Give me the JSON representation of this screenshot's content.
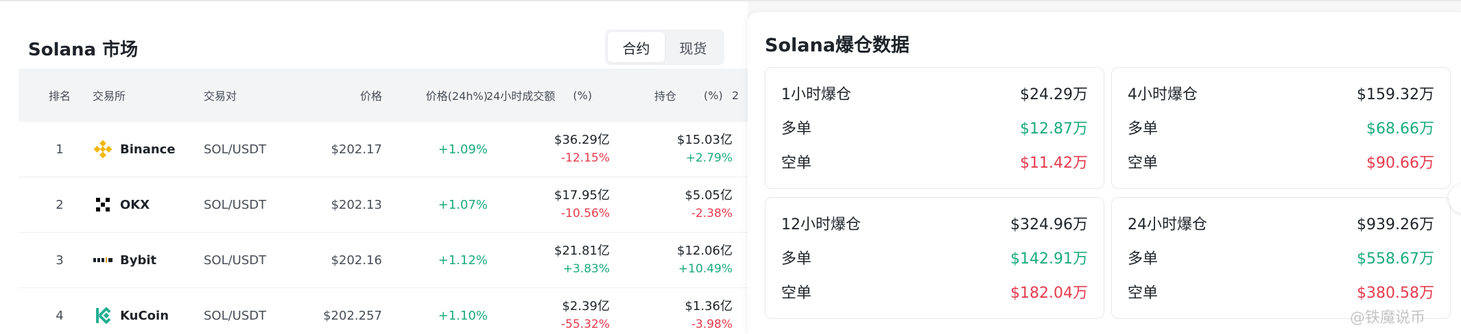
{
  "market": {
    "title": "Solana 市场",
    "tabs": [
      {
        "label": "合约",
        "active": true
      },
      {
        "label": "现货",
        "active": false
      }
    ],
    "columns": {
      "rank": "排名",
      "exchange": "交易所",
      "pair": "交易对",
      "price": "价格",
      "change": "价格(24h%)",
      "volume": "24小时成交额",
      "volume_pct": "(%)",
      "oi": "持仓",
      "oi_pct": "(%)",
      "more": "2"
    },
    "rows": [
      {
        "rank": "1",
        "exchange": "Binance",
        "logo": "binance-logo-icon",
        "pair": "SOL/USDT",
        "price": "$202.17",
        "change": "+1.09%",
        "volume": "$36.29亿",
        "volume_pct": "-12.15%",
        "oi": "$15.03亿",
        "oi_pct": "+2.79%"
      },
      {
        "rank": "2",
        "exchange": "OKX",
        "logo": "okx-logo-icon",
        "pair": "SOL/USDT",
        "price": "$202.13",
        "change": "+1.07%",
        "volume": "$17.95亿",
        "volume_pct": "-10.56%",
        "oi": "$5.05亿",
        "oi_pct": "-2.38%"
      },
      {
        "rank": "3",
        "exchange": "Bybit",
        "logo": "bybit-logo-icon",
        "pair": "SOL/USDT",
        "price": "$202.16",
        "change": "+1.12%",
        "volume": "$21.81亿",
        "volume_pct": "+3.83%",
        "oi": "$12.06亿",
        "oi_pct": "+10.49%"
      },
      {
        "rank": "4",
        "exchange": "KuCoin",
        "logo": "kucoin-logo-icon",
        "pair": "SOL/USDT",
        "price": "$202.257",
        "change": "+1.10%",
        "volume": "$2.39亿",
        "volume_pct": "-55.32%",
        "oi": "$1.36亿",
        "oi_pct": "-3.98%"
      }
    ]
  },
  "liquidation": {
    "title": "Solana爆仓数据",
    "cards": [
      {
        "label": "1小时爆仓",
        "total": "$24.29万",
        "long_label": "多单",
        "long": "$12.87万",
        "short_label": "空单",
        "short": "$11.42万"
      },
      {
        "label": "4小时爆仓",
        "total": "$159.32万",
        "long_label": "多单",
        "long": "$68.66万",
        "short_label": "空单",
        "short": "$90.66万"
      },
      {
        "label": "12小时爆仓",
        "total": "$324.96万",
        "long_label": "多单",
        "long": "$142.91万",
        "short_label": "空单",
        "short": "$182.04万"
      },
      {
        "label": "24小时爆仓",
        "total": "$939.26万",
        "long_label": "多单",
        "long": "$558.67万",
        "short_label": "空单",
        "short": "$380.58万"
      }
    ]
  },
  "watermark": "@铁魔说币",
  "colors": {
    "positive": "#1aab7d",
    "negative": "#e63a4c",
    "binance": "#f0b90b",
    "kucoin": "#23af91"
  }
}
